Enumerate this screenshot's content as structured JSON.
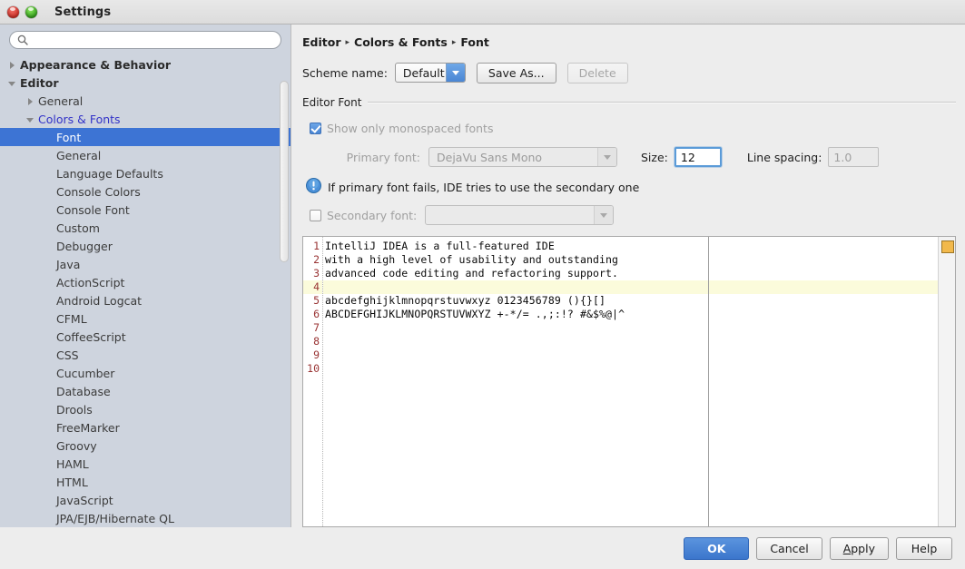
{
  "window": {
    "title": "Settings",
    "controls": [
      {
        "name": "close-button",
        "color": "#cf2b22"
      },
      {
        "name": "zoom-button",
        "color": "#2f9e18"
      }
    ]
  },
  "sidebar": {
    "search": {
      "value": "",
      "placeholder": ""
    },
    "tree": [
      {
        "label": "Appearance & Behavior",
        "level": 0,
        "arrow": "collapsed",
        "selected": false,
        "modified": false
      },
      {
        "label": "Editor",
        "level": 0,
        "arrow": "expanded",
        "selected": false,
        "modified": false
      },
      {
        "label": "General",
        "level": 1,
        "arrow": "collapsed",
        "selected": false,
        "modified": false
      },
      {
        "label": "Colors & Fonts",
        "level": 1,
        "arrow": "expanded",
        "selected": false,
        "modified": true
      },
      {
        "label": "Font",
        "level": 2,
        "arrow": "none",
        "selected": true,
        "modified": false
      },
      {
        "label": "General",
        "level": 2,
        "arrow": "none",
        "selected": false,
        "modified": false
      },
      {
        "label": "Language Defaults",
        "level": 2,
        "arrow": "none",
        "selected": false,
        "modified": false
      },
      {
        "label": "Console Colors",
        "level": 2,
        "arrow": "none",
        "selected": false,
        "modified": false
      },
      {
        "label": "Console Font",
        "level": 2,
        "arrow": "none",
        "selected": false,
        "modified": false
      },
      {
        "label": "Custom",
        "level": 2,
        "arrow": "none",
        "selected": false,
        "modified": false
      },
      {
        "label": "Debugger",
        "level": 2,
        "arrow": "none",
        "selected": false,
        "modified": false
      },
      {
        "label": "Java",
        "level": 2,
        "arrow": "none",
        "selected": false,
        "modified": false
      },
      {
        "label": "ActionScript",
        "level": 2,
        "arrow": "none",
        "selected": false,
        "modified": false
      },
      {
        "label": "Android Logcat",
        "level": 2,
        "arrow": "none",
        "selected": false,
        "modified": false
      },
      {
        "label": "CFML",
        "level": 2,
        "arrow": "none",
        "selected": false,
        "modified": false
      },
      {
        "label": "CoffeeScript",
        "level": 2,
        "arrow": "none",
        "selected": false,
        "modified": false
      },
      {
        "label": "CSS",
        "level": 2,
        "arrow": "none",
        "selected": false,
        "modified": false
      },
      {
        "label": "Cucumber",
        "level": 2,
        "arrow": "none",
        "selected": false,
        "modified": false
      },
      {
        "label": "Database",
        "level": 2,
        "arrow": "none",
        "selected": false,
        "modified": false
      },
      {
        "label": "Drools",
        "level": 2,
        "arrow": "none",
        "selected": false,
        "modified": false
      },
      {
        "label": "FreeMarker",
        "level": 2,
        "arrow": "none",
        "selected": false,
        "modified": false
      },
      {
        "label": "Groovy",
        "level": 2,
        "arrow": "none",
        "selected": false,
        "modified": false
      },
      {
        "label": "HAML",
        "level": 2,
        "arrow": "none",
        "selected": false,
        "modified": false
      },
      {
        "label": "HTML",
        "level": 2,
        "arrow": "none",
        "selected": false,
        "modified": false
      },
      {
        "label": "JavaScript",
        "level": 2,
        "arrow": "none",
        "selected": false,
        "modified": false
      },
      {
        "label": "JPA/EJB/Hibernate QL",
        "level": 2,
        "arrow": "none",
        "selected": false,
        "modified": false
      }
    ]
  },
  "main": {
    "breadcrumb": [
      "Editor",
      "Colors & Fonts",
      "Font"
    ],
    "breadcrumb_separator": "▸",
    "scheme": {
      "label": "Scheme name:",
      "value": "Default",
      "save_as_label": "Save As...",
      "delete_label": "Delete",
      "save_as_enabled": true,
      "delete_enabled": false
    },
    "editor_font": {
      "group_label": "Editor Font",
      "show_monospaced": {
        "label": "Show only monospaced fonts",
        "checked": true,
        "enabled": false
      },
      "primary_font": {
        "label": "Primary font:",
        "value": "DejaVu Sans Mono",
        "enabled": false
      },
      "size": {
        "label": "Size:",
        "value": "12",
        "focused": true
      },
      "line_spacing": {
        "label": "Line spacing:",
        "value": "1.0",
        "enabled": false
      },
      "info_text": "If primary font fails, IDE tries to use the secondary one",
      "info_icon": "info-circle-icon",
      "secondary_font": {
        "label": "Secondary font:",
        "checked": false,
        "enabled": false,
        "value": ""
      }
    },
    "preview": {
      "line_numbers": [
        "1",
        "2",
        "3",
        "4",
        "5",
        "6",
        "7",
        "8",
        "9",
        "10"
      ],
      "caret_line_index": 3,
      "lines": [
        "IntelliJ IDEA is a full-featured IDE",
        "with a high level of usability and outstanding",
        "advanced code editing and refactoring support.",
        "",
        "abcdefghijklmnopqrstuvwxyz 0123456789 (){}[]",
        "ABCDEFGHIJKLMNOPQRSTUVWXYZ +-*/= .,;:!? #&$%@|^",
        "",
        "",
        "",
        ""
      ],
      "caret_line_color": "#fbfbdb",
      "line_number_color": "#993333",
      "marker_color": "#f2b94c"
    }
  },
  "footer": {
    "ok": "OK",
    "cancel": "Cancel",
    "apply_prefix": "A",
    "apply_rest": "pply",
    "help": "Help"
  }
}
